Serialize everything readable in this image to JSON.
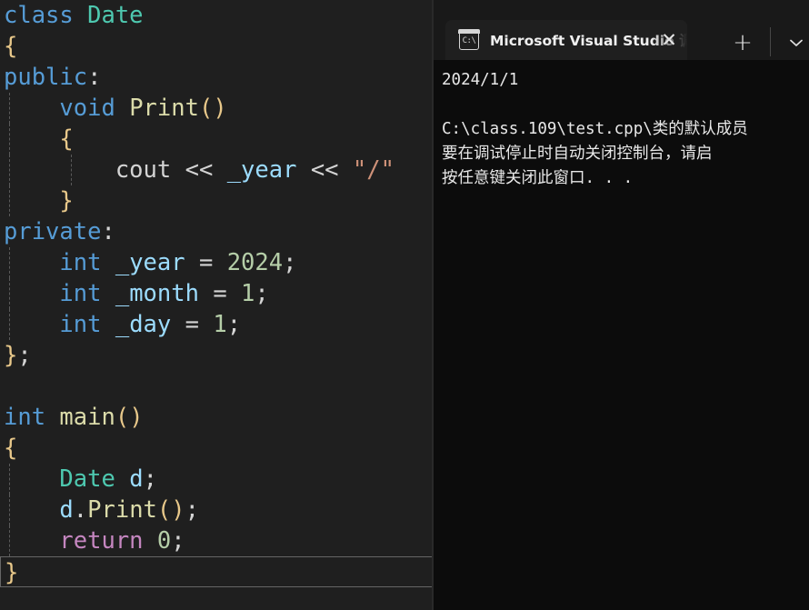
{
  "editor": {
    "language": "cpp",
    "background": "#1f1f1f",
    "current_line_index": 16,
    "lines": [
      {
        "tokens": [
          {
            "t": "class",
            "c": "kw"
          },
          {
            "t": " ",
            "c": "pn"
          },
          {
            "t": "Date",
            "c": "typ"
          }
        ],
        "indent": 0
      },
      {
        "tokens": [
          {
            "t": "{",
            "c": "br"
          }
        ],
        "indent": 0
      },
      {
        "tokens": [
          {
            "t": "public",
            "c": "kw"
          },
          {
            "t": ":",
            "c": "pn"
          }
        ],
        "indent": 0
      },
      {
        "tokens": [
          {
            "t": "    ",
            "c": "pn"
          },
          {
            "t": "void",
            "c": "kw"
          },
          {
            "t": " ",
            "c": "pn"
          },
          {
            "t": "Print",
            "c": "fn"
          },
          {
            "t": "()",
            "c": "br"
          }
        ],
        "indent": 1
      },
      {
        "tokens": [
          {
            "t": "    ",
            "c": "pn"
          },
          {
            "t": "{",
            "c": "br"
          }
        ],
        "indent": 1
      },
      {
        "tokens": [
          {
            "t": "        ",
            "c": "pn"
          },
          {
            "t": "cout",
            "c": "pn"
          },
          {
            "t": " ",
            "c": "pn"
          },
          {
            "t": "<<",
            "c": "op"
          },
          {
            "t": " ",
            "c": "pn"
          },
          {
            "t": "_year",
            "c": "var"
          },
          {
            "t": " ",
            "c": "pn"
          },
          {
            "t": "<<",
            "c": "op"
          },
          {
            "t": " ",
            "c": "pn"
          },
          {
            "t": "\"/\"",
            "c": "str"
          }
        ],
        "indent": 2
      },
      {
        "tokens": [
          {
            "t": "    ",
            "c": "pn"
          },
          {
            "t": "}",
            "c": "br"
          }
        ],
        "indent": 1
      },
      {
        "tokens": [
          {
            "t": "private",
            "c": "kw"
          },
          {
            "t": ":",
            "c": "pn"
          }
        ],
        "indent": 0
      },
      {
        "tokens": [
          {
            "t": "    ",
            "c": "pn"
          },
          {
            "t": "int",
            "c": "kw"
          },
          {
            "t": " ",
            "c": "pn"
          },
          {
            "t": "_year",
            "c": "var"
          },
          {
            "t": " ",
            "c": "pn"
          },
          {
            "t": "=",
            "c": "op"
          },
          {
            "t": " ",
            "c": "pn"
          },
          {
            "t": "2024",
            "c": "num"
          },
          {
            "t": ";",
            "c": "pn"
          }
        ],
        "indent": 1
      },
      {
        "tokens": [
          {
            "t": "    ",
            "c": "pn"
          },
          {
            "t": "int",
            "c": "kw"
          },
          {
            "t": " ",
            "c": "pn"
          },
          {
            "t": "_month",
            "c": "var"
          },
          {
            "t": " ",
            "c": "pn"
          },
          {
            "t": "=",
            "c": "op"
          },
          {
            "t": " ",
            "c": "pn"
          },
          {
            "t": "1",
            "c": "num"
          },
          {
            "t": ";",
            "c": "pn"
          }
        ],
        "indent": 1
      },
      {
        "tokens": [
          {
            "t": "    ",
            "c": "pn"
          },
          {
            "t": "int",
            "c": "kw"
          },
          {
            "t": " ",
            "c": "pn"
          },
          {
            "t": "_day",
            "c": "var"
          },
          {
            "t": " ",
            "c": "pn"
          },
          {
            "t": "=",
            "c": "op"
          },
          {
            "t": " ",
            "c": "pn"
          },
          {
            "t": "1",
            "c": "num"
          },
          {
            "t": ";",
            "c": "pn"
          }
        ],
        "indent": 1
      },
      {
        "tokens": [
          {
            "t": "}",
            "c": "br"
          },
          {
            "t": ";",
            "c": "pn"
          }
        ],
        "indent": 0
      },
      {
        "tokens": [],
        "indent": 0
      },
      {
        "tokens": [
          {
            "t": "int",
            "c": "kw"
          },
          {
            "t": " ",
            "c": "pn"
          },
          {
            "t": "main",
            "c": "fn"
          },
          {
            "t": "()",
            "c": "br"
          }
        ],
        "indent": 0
      },
      {
        "tokens": [
          {
            "t": "{",
            "c": "br"
          }
        ],
        "indent": 0
      },
      {
        "tokens": [
          {
            "t": "    ",
            "c": "pn"
          },
          {
            "t": "Date",
            "c": "typ"
          },
          {
            "t": " ",
            "c": "pn"
          },
          {
            "t": "d",
            "c": "var"
          },
          {
            "t": ";",
            "c": "pn"
          }
        ],
        "indent": 1
      },
      {
        "tokens": [
          {
            "t": "    ",
            "c": "pn"
          },
          {
            "t": "d",
            "c": "var"
          },
          {
            "t": ".",
            "c": "pn"
          },
          {
            "t": "Print",
            "c": "fn"
          },
          {
            "t": "()",
            "c": "br"
          },
          {
            "t": ";",
            "c": "pn"
          }
        ],
        "indent": 1
      },
      {
        "tokens": [
          {
            "t": "    ",
            "c": "pn"
          },
          {
            "t": "return",
            "c": "ctl"
          },
          {
            "t": " ",
            "c": "pn"
          },
          {
            "t": "0",
            "c": "num"
          },
          {
            "t": ";",
            "c": "pn"
          }
        ],
        "indent": 1
      },
      {
        "tokens": [
          {
            "t": "}",
            "c": "br"
          }
        ],
        "indent": 0,
        "current": true
      }
    ],
    "colors": {
      "keyword": "#569cd6",
      "type": "#4ec9b0",
      "function": "#dcdcaa",
      "number": "#b5cea8",
      "string": "#ce9178",
      "control": "#c586c0",
      "variable": "#9cdcfe",
      "punctuation": "#d4d4d4",
      "bracket": "#e8c88a"
    }
  },
  "terminal": {
    "background": "#0c0c0c",
    "titlebar_background": "#191919",
    "tab": {
      "icon": "console-icon",
      "icon_glyph": "C:\\",
      "title": "Microsoft Visual Studio 调试控",
      "close_label": "✕"
    },
    "new_tab_label": "+",
    "dropdown_label": "⌄",
    "output_lines": [
      "2024/1/1",
      "",
      "C:\\class.109\\test.cpp\\类的默认成员",
      "要在调试停止时自动关闭控制台，请启",
      "按任意键关闭此窗口. . ."
    ]
  }
}
